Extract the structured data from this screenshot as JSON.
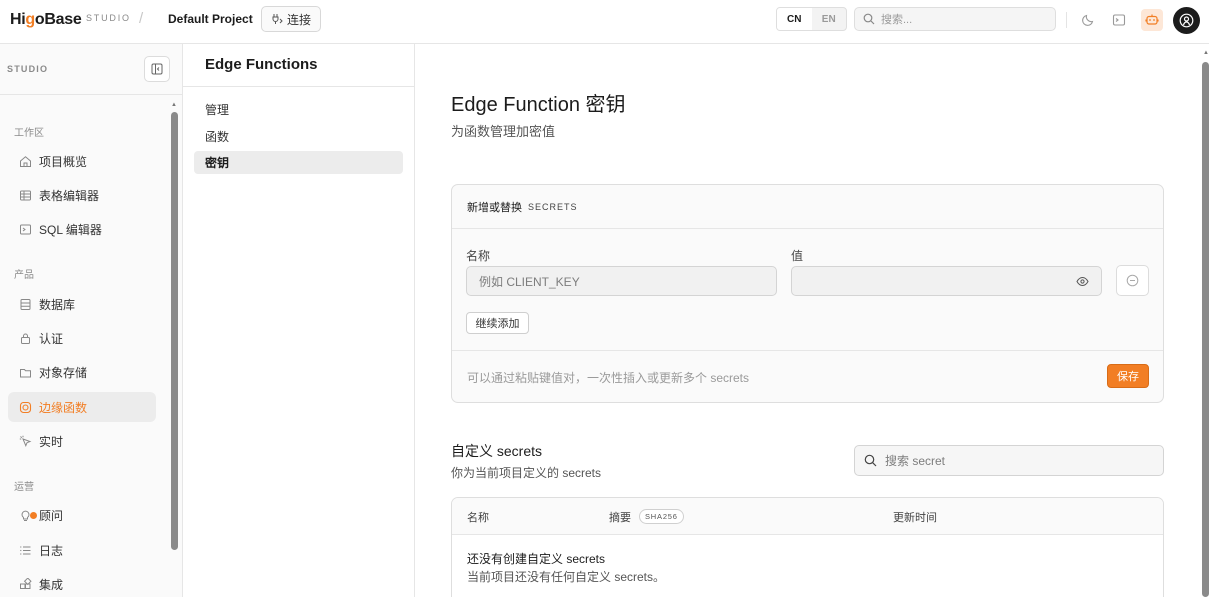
{
  "topbar": {
    "logo_pre": "Hi",
    "logo_o": "g",
    "logo_post": "oBase",
    "studio_tag": "STUDIO",
    "separator": "/",
    "project_name": "Default Project",
    "connect_label": "连接",
    "lang": {
      "cn": "CN",
      "en": "EN",
      "active": "CN"
    },
    "search_placeholder": "搜索...",
    "accent": "#f27e24"
  },
  "sidebar": {
    "studio_label": "STUDIO",
    "sections": [
      {
        "label": "工作区",
        "items": [
          "项目概览",
          "表格编辑器",
          "SQL 编辑器"
        ]
      },
      {
        "label": "产品",
        "items": [
          "数据库",
          "认证",
          "对象存储",
          "边缘函数",
          "实时"
        ]
      },
      {
        "label": "运营",
        "items": [
          "顾问",
          "日志",
          "集成"
        ]
      }
    ],
    "active_item": "边缘函数"
  },
  "submenu": {
    "title": "Edge Functions",
    "items": [
      "管理",
      "函数",
      "密钥"
    ],
    "active": "密钥"
  },
  "main": {
    "title": "Edge Function 密钥",
    "subtitle": "为函数管理加密值",
    "form_card": {
      "header_cn": "新增或替换",
      "header_en": "SECRETS",
      "name_label": "名称",
      "name_placeholder": "例如 CLIENT_KEY",
      "value_label": "值",
      "value_value": "",
      "add_more_label": "继续添加",
      "hint": "可以通过粘贴键值对，一次性插入或更新多个 secrets",
      "save_label": "保存"
    },
    "custom_secrets": {
      "title": "自定义 secrets",
      "subtitle": "你为当前项目定义的 secrets",
      "search_placeholder": "搜索 secret",
      "columns": {
        "name": "名称",
        "digest": "摘要",
        "digest_badge": "SHA256",
        "updated": "更新时间"
      },
      "empty_title": "还没有创建自定义 secrets",
      "empty_sub": "当前项目还没有任何自定义 secrets。"
    }
  }
}
